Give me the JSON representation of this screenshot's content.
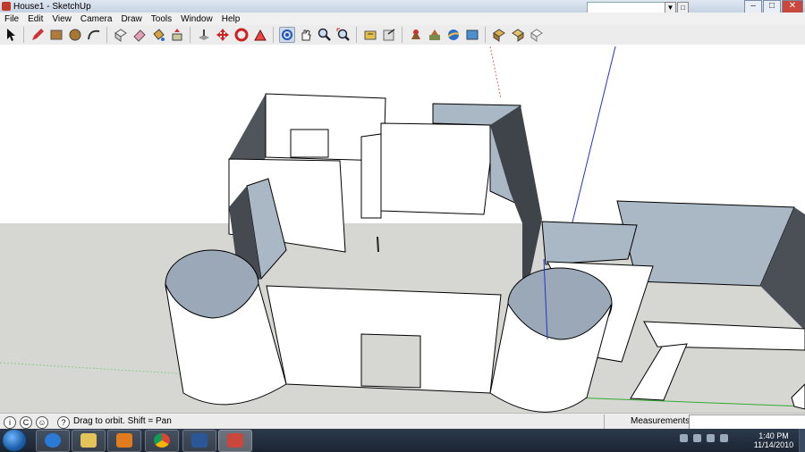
{
  "window": {
    "title": "House1 - SketchUp"
  },
  "menu": [
    "File",
    "Edit",
    "View",
    "Camera",
    "Draw",
    "Tools",
    "Window",
    "Help"
  ],
  "search": {
    "value": ""
  },
  "toolbar": {
    "tools": [
      "select-tool",
      "pencil-tool",
      "rectangle-tool",
      "circle-tool",
      "arc-tool",
      "make-component-tool",
      "eraser-tool",
      "paint-bucket-tool",
      "push-pull-tool",
      "follow-me-tool",
      "offset-tool",
      "move-tool",
      "rotate-tool",
      "scale-tool",
      "orbit-tool",
      "pan-tool",
      "zoom-tool",
      "zoom-extents-tool",
      "tape-measure-tool",
      "text-tool",
      "axes-tool",
      "get-models-tool",
      "share-model-tool",
      "google-earth-tool",
      "component-tool",
      "extension-tool",
      "3d-text-tool"
    ]
  },
  "status": {
    "hint": "Drag to orbit.  Shift = Pan",
    "measurements_label": "Measurements",
    "measurements_value": ""
  },
  "taskbar": {
    "time": "1:40 PM",
    "date": "11/14/2010"
  },
  "colors": {
    "wall_face": "#ffffff",
    "wall_side": "#aab8c6",
    "wall_dark": "#4a4f55",
    "ground": "#d6d6d2",
    "sky": "#ffffff"
  }
}
